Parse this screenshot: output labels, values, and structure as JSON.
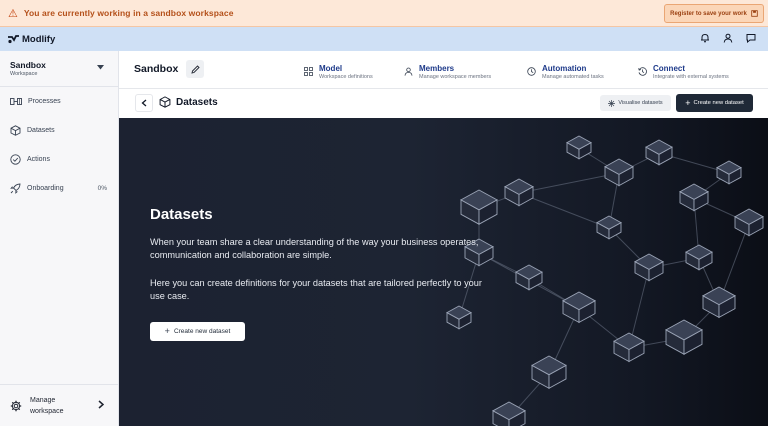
{
  "banner": {
    "message": "You are currently working in a sandbox workspace",
    "register_label": "Register to save your work"
  },
  "topbar": {
    "brand": "Modlify"
  },
  "sidebar": {
    "workspace_name": "Sandbox",
    "workspace_sub": "Workspace",
    "items": [
      {
        "label": "Processes",
        "icon": "processes-icon"
      },
      {
        "label": "Datasets",
        "icon": "cube-icon"
      },
      {
        "label": "Actions",
        "icon": "check-circle-icon"
      },
      {
        "label": "Onboarding",
        "icon": "rocket-icon",
        "badge": "0%"
      }
    ],
    "manage_line1": "Manage",
    "manage_line2": "workspace"
  },
  "header": {
    "title": "Sandbox",
    "nav": [
      {
        "title": "Model",
        "sub": "Workspace definitions",
        "icon": "grid-icon"
      },
      {
        "title": "Members",
        "sub": "Manage workspace members",
        "icon": "user-icon"
      },
      {
        "title": "Automation",
        "sub": "Manage automated tasks",
        "icon": "clock-icon"
      },
      {
        "title": "Connect",
        "sub": "Integrate with external systems",
        "icon": "history-icon"
      }
    ]
  },
  "subheader": {
    "title": "Datasets",
    "visualise_label": "Visualise datasets",
    "create_label": "Create new dataset"
  },
  "hero": {
    "title": "Datasets",
    "para1": "When your team share a clear understanding of the way your business operates, communication and collaboration are simple.",
    "para2": "Here you can create definitions for your datasets that are tailored perfectly to your use case.",
    "button_label": "Create new dataset"
  },
  "colors": {
    "banner_bg": "#fde8d8",
    "topbar_bg": "#cfe0f5",
    "hero_bg": "#1c2231",
    "accent": "#1e3a8a"
  }
}
